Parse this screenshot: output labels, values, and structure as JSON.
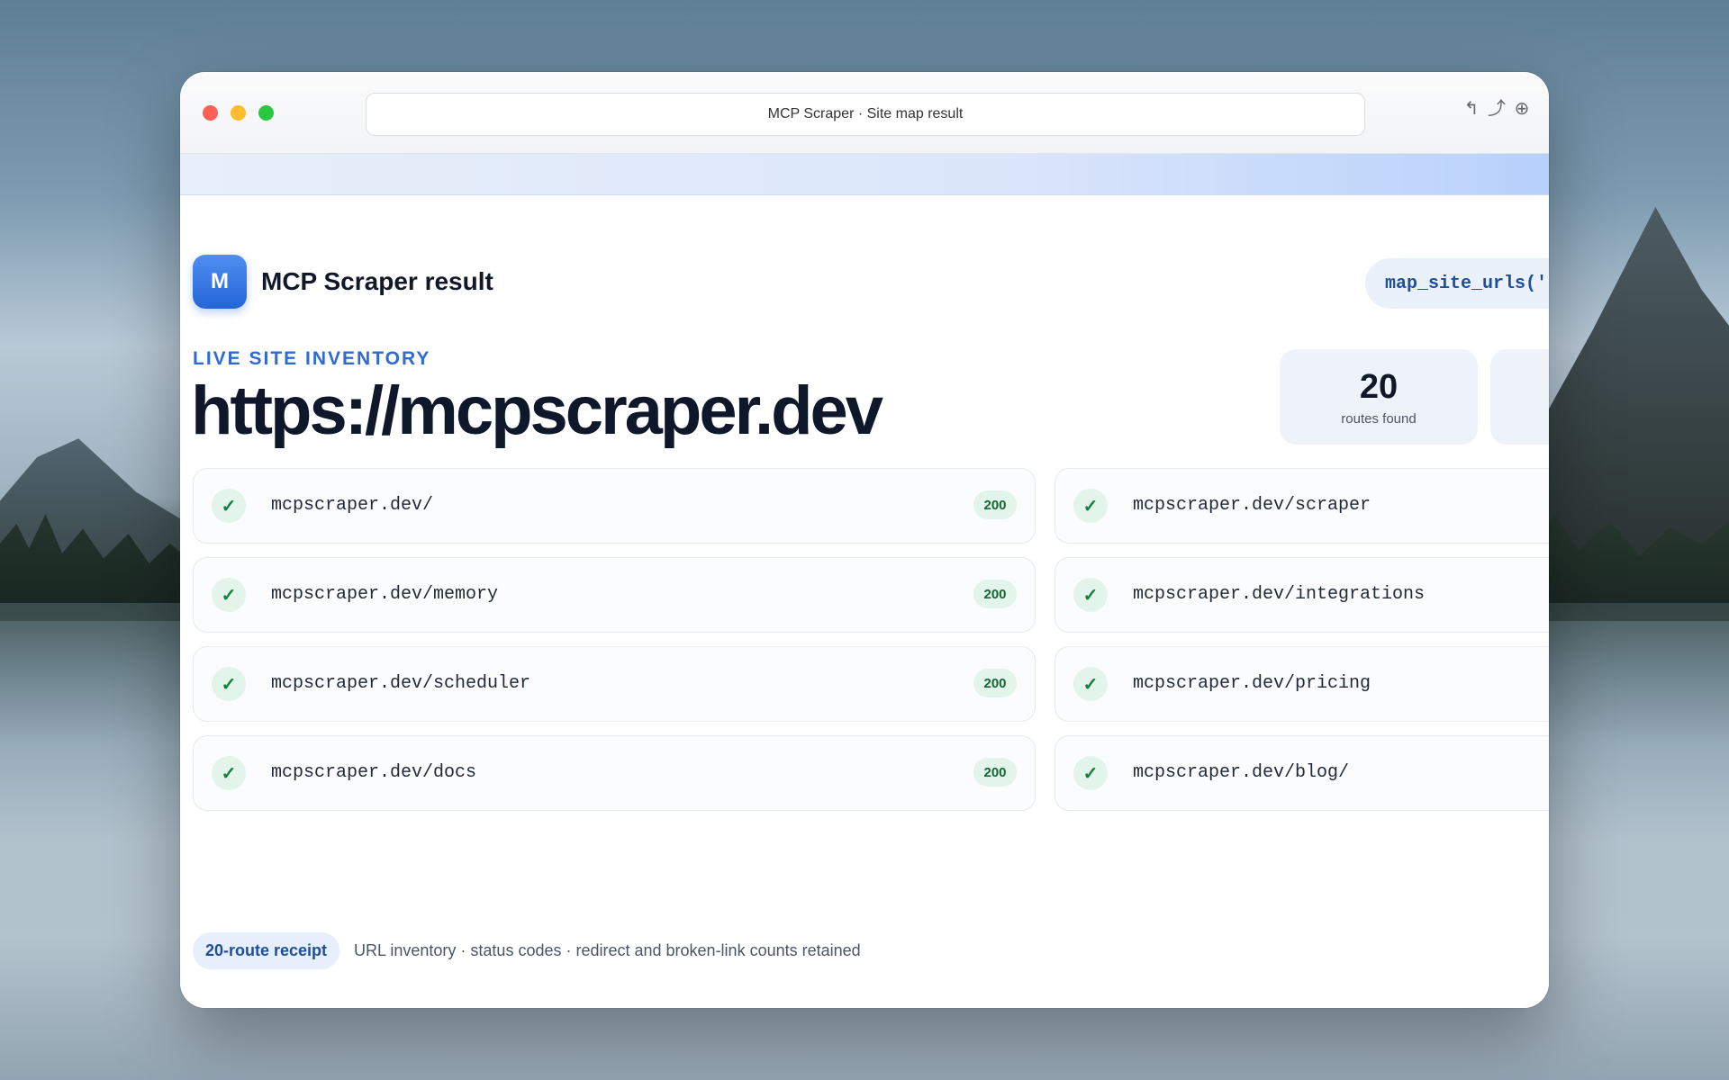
{
  "window": {
    "title": "MCP Scraper · Site map result",
    "toolbar_icons": [
      "back-icon",
      "share-icon",
      "globe-icon"
    ]
  },
  "header": {
    "logo_letter": "M",
    "title": "MCP Scraper result",
    "tool_call": "map_site_urls('"
  },
  "hero": {
    "eyebrow": "LIVE SITE INVENTORY",
    "url": "https://mcpscraper.dev"
  },
  "stats": [
    {
      "value": "20",
      "label": "routes found"
    },
    {
      "value": "",
      "label": ""
    }
  ],
  "routes": {
    "left": [
      {
        "url": "mcpscraper.dev/",
        "status": "200"
      },
      {
        "url": "mcpscraper.dev/memory",
        "status": "200"
      },
      {
        "url": "mcpscraper.dev/scheduler",
        "status": "200"
      },
      {
        "url": "mcpscraper.dev/docs",
        "status": "200"
      }
    ],
    "right": [
      {
        "url": "mcpscraper.dev/scraper"
      },
      {
        "url": "mcpscraper.dev/integrations"
      },
      {
        "url": "mcpscraper.dev/pricing"
      },
      {
        "url": "mcpscraper.dev/blog/"
      }
    ],
    "check_glyph": "✓"
  },
  "footer": {
    "receipt_label": "20-route receipt",
    "receipt_text": "URL inventory · status codes · redirect and broken-link counts retained"
  },
  "colors": {
    "accent": "#2f6bd0",
    "success": "#15803d",
    "close": "#ff5f57",
    "minimize": "#febc2e",
    "zoom": "#28c840"
  }
}
